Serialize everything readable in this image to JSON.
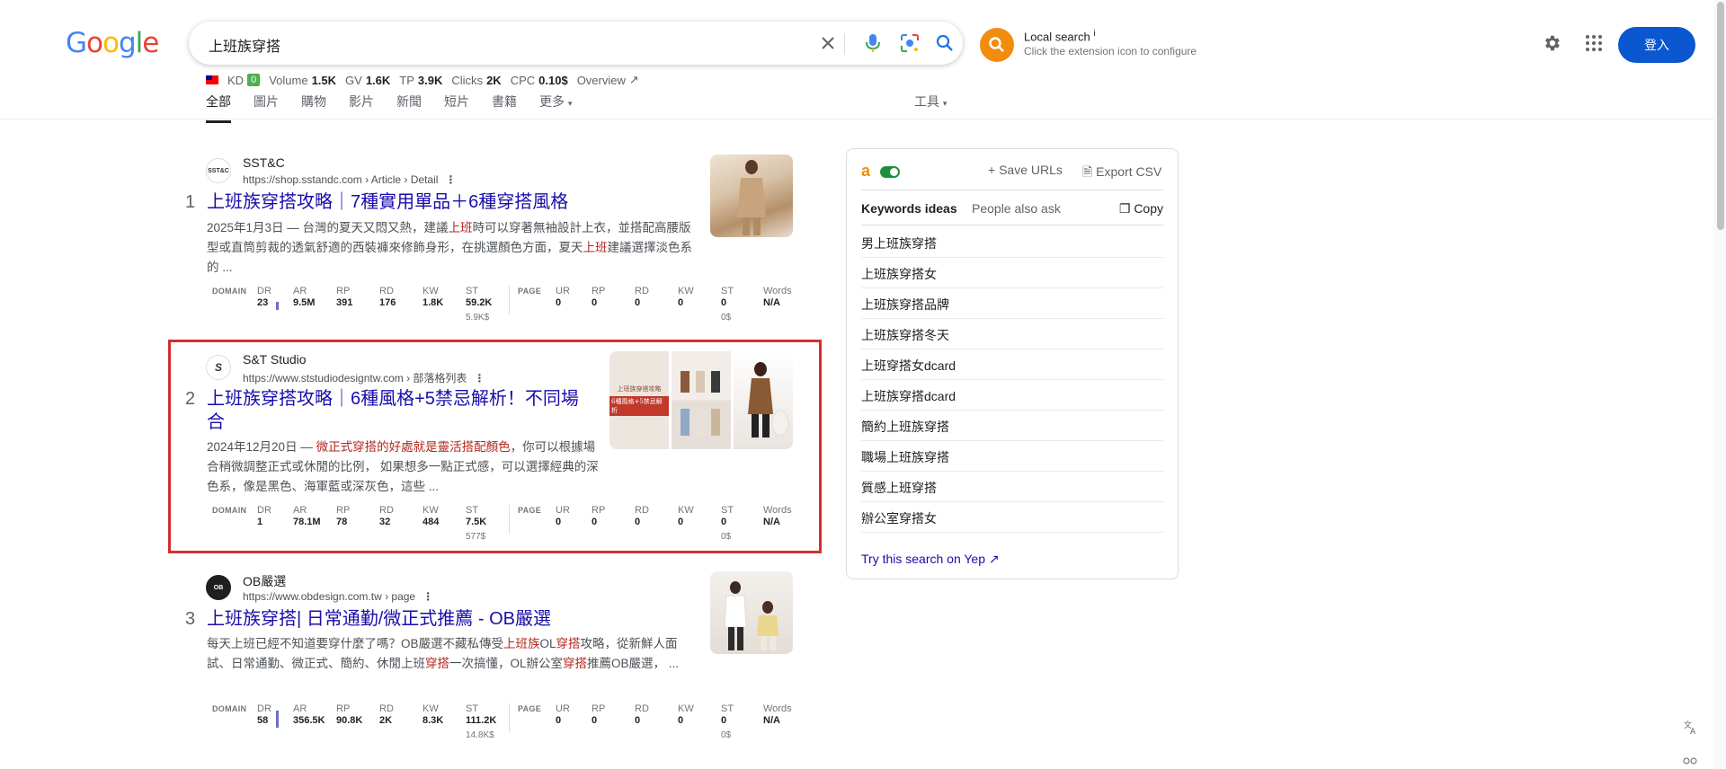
{
  "logo": {
    "letters": [
      "G",
      "o",
      "o",
      "g",
      "l",
      "e"
    ],
    "colors": [
      "#4285f4",
      "#ea4335",
      "#fbbc05",
      "#4285f4",
      "#34a853",
      "#ea4335"
    ]
  },
  "search": {
    "query": "上班族穿搭"
  },
  "extension": {
    "title": "Local search",
    "info": "i",
    "subtitle": "Click the extension icon to configure"
  },
  "header": {
    "signin_label": "登入"
  },
  "metrics": {
    "kd_label": "KD",
    "kd_value": "0",
    "volume_label": "Volume",
    "volume_value": "1.5K",
    "gv_label": "GV",
    "gv_value": "1.6K",
    "tp_label": "TP",
    "tp_value": "3.9K",
    "clicks_label": "Clicks",
    "clicks_value": "2K",
    "cpc_label": "CPC",
    "cpc_value": "0.10$",
    "overview_label": "Overview"
  },
  "tabs": [
    "全部",
    "圖片",
    "購物",
    "影片",
    "新聞",
    "短片",
    "書籍",
    "更多"
  ],
  "tools_label": "工具",
  "metric_labels": {
    "domain": "DOMAIN",
    "page": "PAGE",
    "dr": "DR",
    "ar": "AR",
    "rp": "RP",
    "rd": "RD",
    "kw": "KW",
    "st": "ST",
    "ur": "UR",
    "words": "Words"
  },
  "results": [
    {
      "num": "1",
      "site": "SST&C",
      "favicon": "SST&C",
      "url": "https://shop.sstandc.com › Article › Detail",
      "title": "上班族穿搭攻略｜7種實用單品＋6種穿搭風格",
      "snippet": [
        "2025年1月3日 — 台灣的夏天又悶又熱，建議",
        "上班",
        "時可以穿著無袖設計上衣，並搭配高腰版型或直筒剪裁的透氣舒適的西裝褲來修飾身形，在挑選顏色方面，夏天",
        "上班",
        "建議選擇淡色系的 ..."
      ],
      "domain": {
        "dr": "23",
        "ar": "9.5M",
        "rp": "391",
        "rd": "176",
        "kw": "1.8K",
        "st": "59.2K",
        "st_sub": "5.9K$",
        "dr_level": 0.23
      },
      "page": {
        "ur": "0",
        "rp": "0",
        "rd": "0",
        "kw": "0",
        "st": "0",
        "st_sub": "0$",
        "words": "N/A"
      }
    },
    {
      "num": "2",
      "site": "S&T Studio",
      "favicon": "S",
      "url": "https://www.ststudiodesigntw.com › 部落格列表",
      "title_line1": "上班族穿搭攻略｜6種風格+5禁忌解析！不同場",
      "title_line2": "合",
      "snippet": [
        "2024年12月20日 — ",
        "微正式穿搭的好處就是靈活搭配顏色",
        "，你可以根據場合稍微調整正式或休閒的比例， 如果想多一點正式感，可以選擇經典的深色系，像是黑色、海軍藍或深灰色，這些 ..."
      ],
      "thumb_texts": [
        "上班族穿搭攻略",
        "6種風格+5禁忌解析"
      ],
      "domain": {
        "dr": "1",
        "ar": "78.1M",
        "rp": "78",
        "rd": "32",
        "kw": "484",
        "st": "7.5K",
        "st_sub": "577$",
        "dr_level": 0.01
      },
      "page": {
        "ur": "0",
        "rp": "0",
        "rd": "0",
        "kw": "0",
        "st": "0",
        "st_sub": "0$",
        "words": "N/A"
      }
    },
    {
      "num": "3",
      "site": "OB嚴選",
      "favicon": "OB",
      "url": "https://www.obdesign.com.tw › page",
      "title": "上班族穿搭| 日常通勤/微正式推薦 - OB嚴選",
      "snippet": [
        "每天上班已經不知道要穿什麼了嗎？OB嚴選不藏私傳受",
        "上班族",
        "OL",
        "穿搭",
        "攻略，從新鮮人面試、日常通勤、微正式、簡約、休閒上班",
        "穿搭",
        "一次搞懂，OL辦公室",
        "穿搭",
        "推薦OB嚴選， ..."
      ],
      "domain": {
        "dr": "58",
        "ar": "356.5K",
        "rp": "90.8K",
        "rd": "2K",
        "kw": "8.3K",
        "st": "111.2K",
        "st_sub": "14.8K$",
        "dr_level": 0.58
      },
      "page": {
        "ur": "0",
        "rp": "0",
        "rd": "0",
        "kw": "0",
        "st": "0",
        "st_sub": "0$",
        "words": "N/A"
      }
    }
  ],
  "panel": {
    "logo": "a",
    "save_urls": "Save URLs",
    "export_csv": "Export CSV",
    "tab_keywords": "Keywords ideas",
    "tab_paa": "People also ask",
    "copy": "Copy",
    "keywords": [
      "男上班族穿搭",
      "上班族穿搭女",
      "上班族穿搭品牌",
      "上班族穿搭冬天",
      "上班穿搭女dcard",
      "上班族穿搭dcard",
      "簡約上班族穿搭",
      "職場上班族穿搭",
      "質感上班穿搭",
      "辦公室穿搭女"
    ],
    "yep_link": "Try this search on Yep"
  },
  "colors": {
    "link": "#1a0dab",
    "highlight_border": "#d32f2f",
    "signin_bg": "#0b57d0",
    "ext_orange": "#f28c0f",
    "snippet_em": "#b3261e"
  }
}
